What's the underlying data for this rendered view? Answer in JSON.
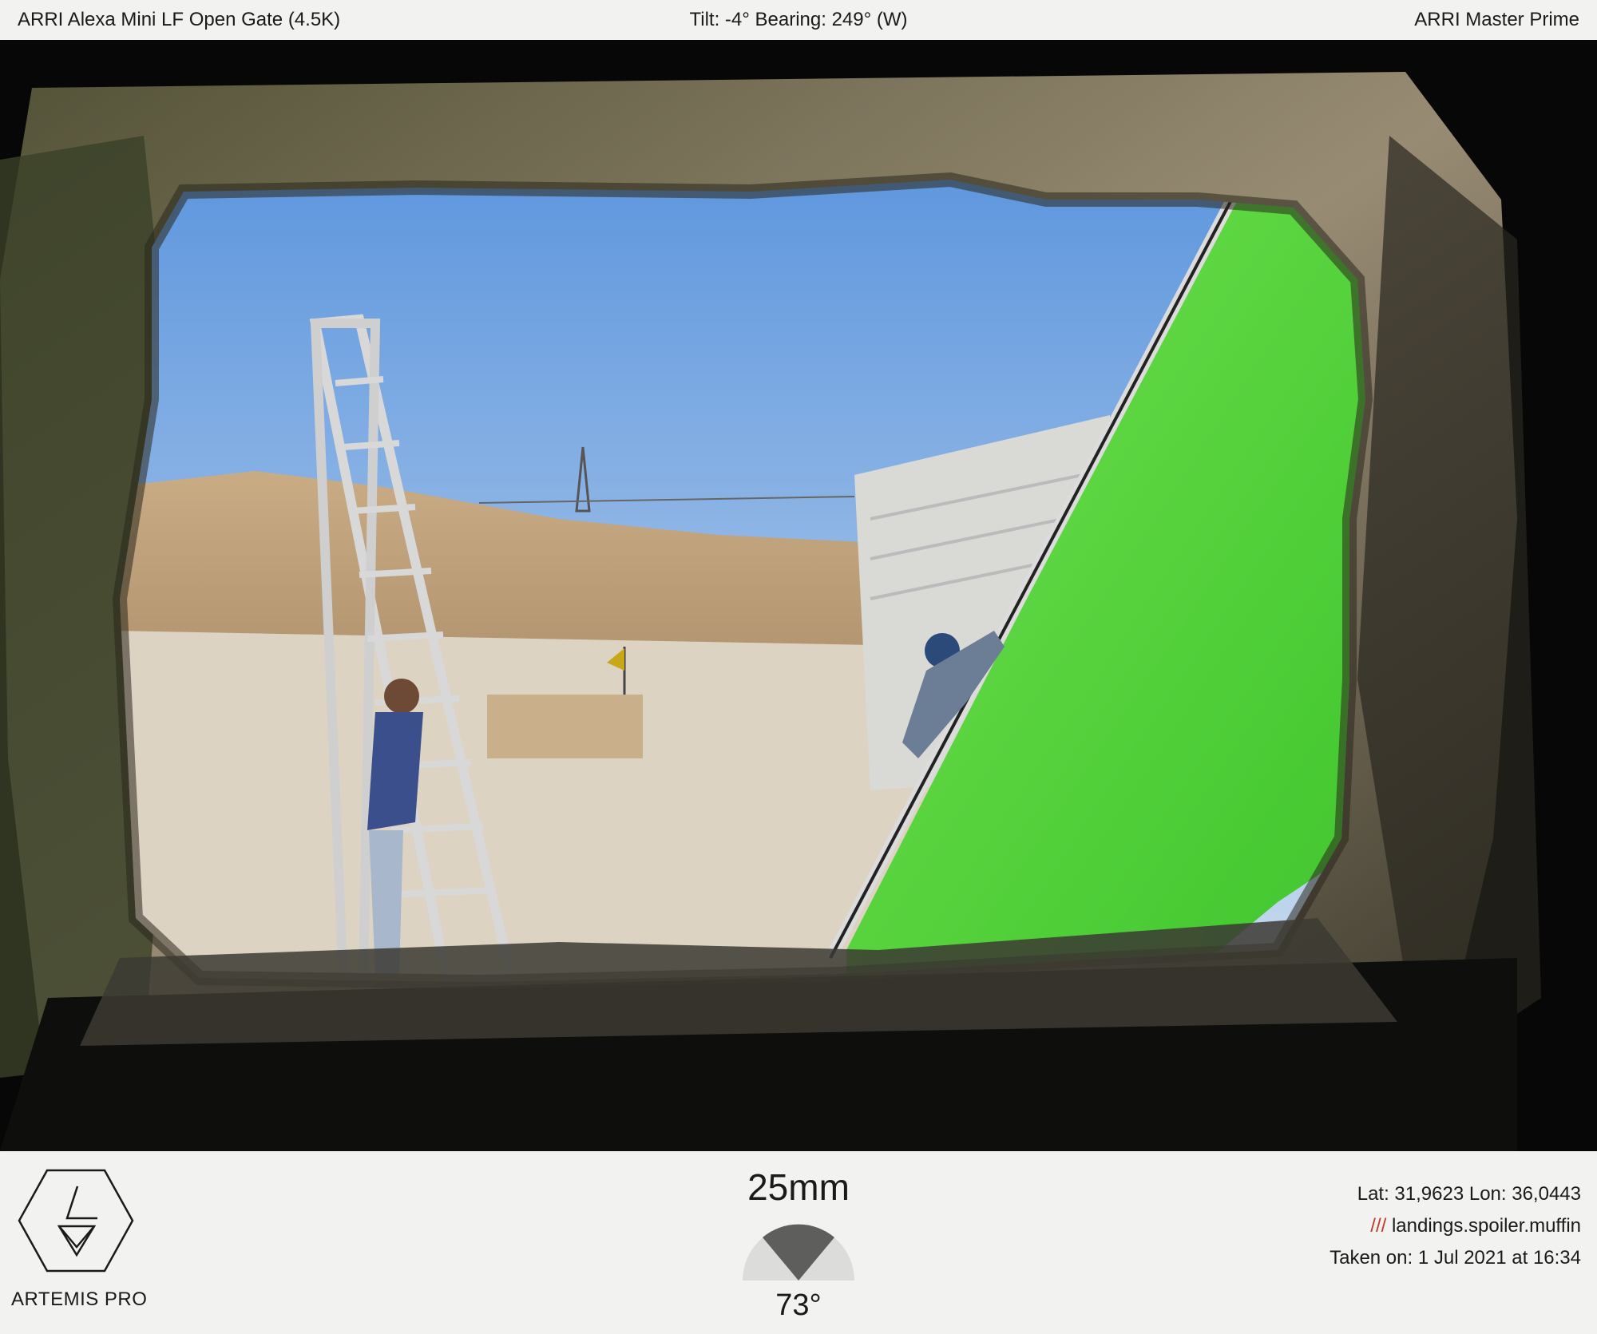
{
  "header": {
    "camera": "ARRI Alexa Mini LF Open Gate (4.5K)",
    "orientation": "Tilt: -4° Bearing: 249° (W)",
    "lens_set": "ARRI Master Prime"
  },
  "footer": {
    "brand": "ARTEMIS PRO",
    "focal_length": "25mm",
    "field_of_view": "73°",
    "location": "Lat: 31,9623  Lon: 36,0443",
    "w3w_prefix": "///",
    "w3w_address": " landings.spoiler.muffin",
    "taken_on": "Taken on: 1 Jul 2021 at 16:34"
  },
  "colors": {
    "background": "#f2f2f0",
    "green_screen": "#4fd63a",
    "sky": "#8fb8e6",
    "w3w_slashes": "#c0392b"
  },
  "icons": {
    "logo": "artemis-hexagon-logo",
    "fov": "field-of-view-wedge-icon"
  }
}
